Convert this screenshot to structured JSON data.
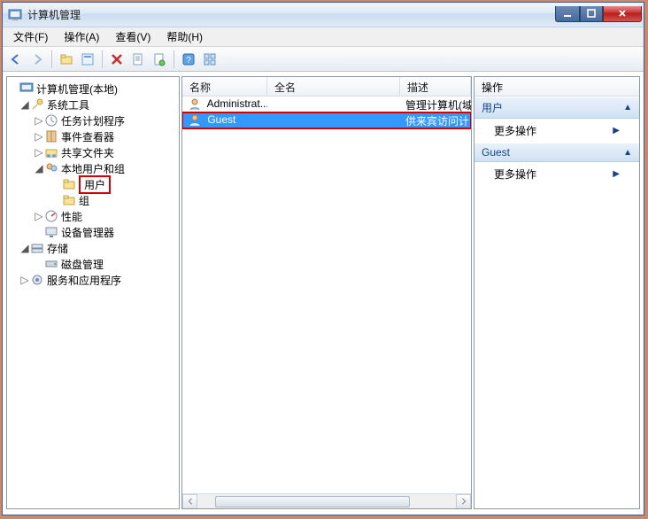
{
  "window": {
    "title": "计算机管理"
  },
  "menu": {
    "file": "文件(F)",
    "action": "操作(A)",
    "view": "查看(V)",
    "help": "帮助(H)"
  },
  "toolbar_icons": {
    "back": "back-arrow-icon",
    "forward": "forward-arrow-icon",
    "up": "up-folder-icon",
    "props": "properties-icon",
    "delete": "delete-icon",
    "new1": "new-doc-icon",
    "new2": "new-doc2-icon",
    "help": "help-icon",
    "tile": "tile-icon"
  },
  "tree": {
    "root": "计算机管理(本地)",
    "systools": "系统工具",
    "task": "任务计划程序",
    "eventv": "事件查看器",
    "shared": "共享文件夹",
    "localug": "本地用户和组",
    "users": "用户",
    "groups": "组",
    "perf": "性能",
    "devmgr": "设备管理器",
    "storage": "存储",
    "diskmgr": "磁盘管理",
    "services": "服务和应用程序"
  },
  "list": {
    "columns": {
      "name": "名称",
      "fullname": "全名",
      "desc": "描述"
    },
    "rows": [
      {
        "name": "Administrat...",
        "fullname": "",
        "desc": "管理计算机(域"
      },
      {
        "name": "Guest",
        "fullname": "",
        "desc": "供来宾访问计"
      }
    ]
  },
  "actions": {
    "header": "操作",
    "section1": "用户",
    "link1": "更多操作",
    "section2": "Guest",
    "link2": "更多操作"
  },
  "glyphs": {
    "tri_right": "▷",
    "tri_down": "◢",
    "collapse": "▲",
    "more": "▶"
  }
}
